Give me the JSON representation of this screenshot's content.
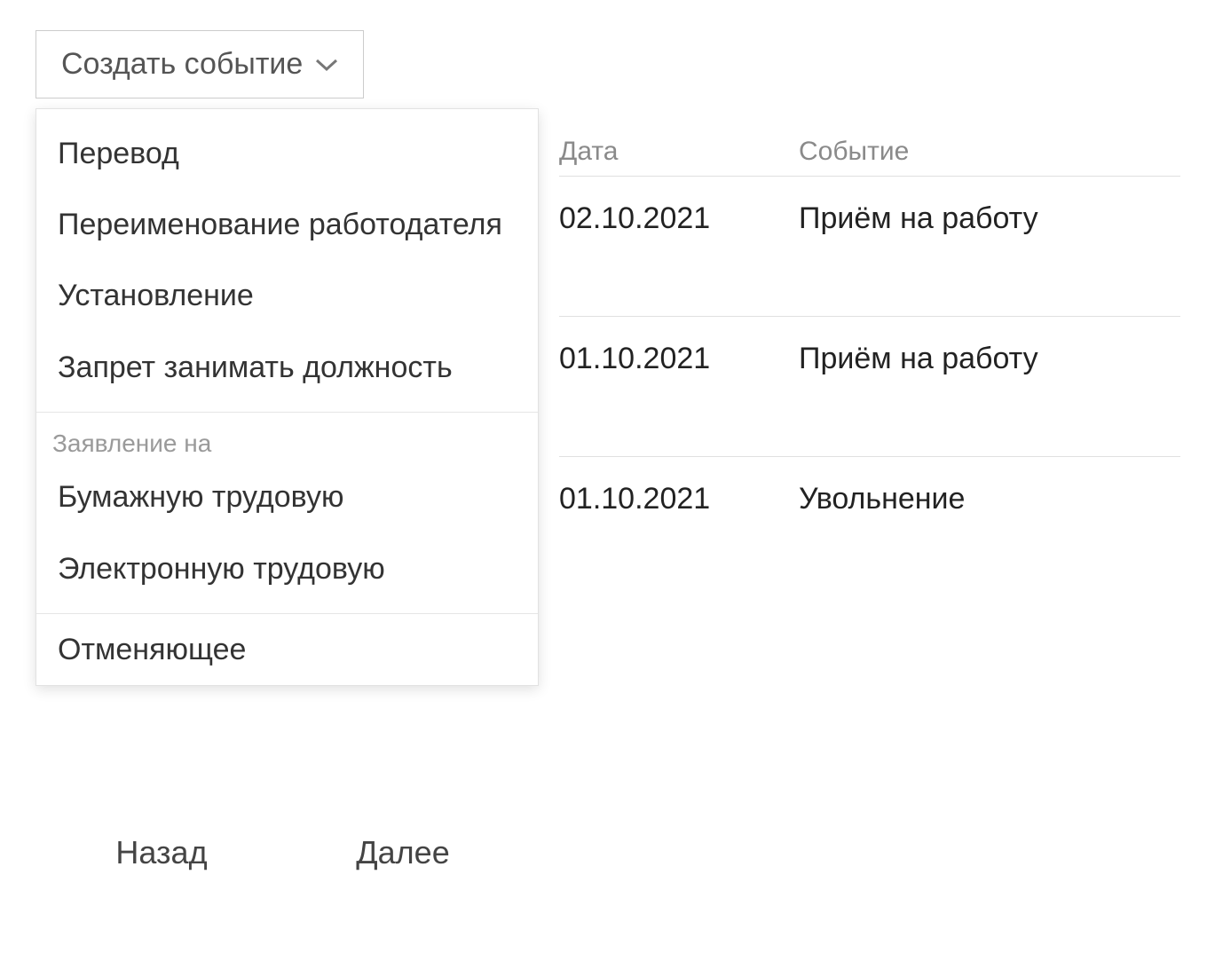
{
  "createButton": {
    "label": "Создать событие"
  },
  "menu": {
    "group1": {
      "item0": "Перевод",
      "item1": "Переименование работодателя",
      "item2": "Установление",
      "item3": "Запрет занимать должность"
    },
    "group2": {
      "label": "Заявление на",
      "item0": "Бумажную трудовую",
      "item1": "Электронную трудовую"
    },
    "group3": {
      "item0": "Отменяющее"
    }
  },
  "table": {
    "headers": {
      "date": "Дата",
      "event": "Событие"
    },
    "rows": [
      {
        "date": "02.10.2021",
        "event": "Приём на работу"
      },
      {
        "date": "01.10.2021",
        "event": "Приём на работу"
      },
      {
        "date": "01.10.2021",
        "event": "Увольнение"
      }
    ]
  },
  "nav": {
    "back": "Назад",
    "next": "Далее"
  }
}
